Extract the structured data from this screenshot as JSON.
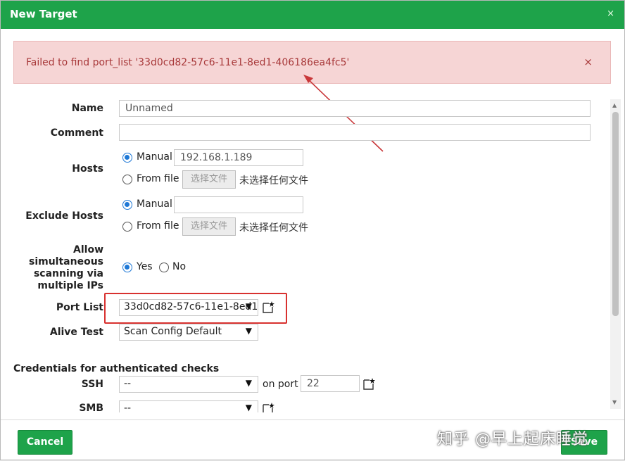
{
  "dialog": {
    "title": "New Target",
    "close": "×"
  },
  "error": {
    "message": "Failed to find port_list '33d0cd82-57c6-11e1-8ed1-406186ea4fc5'",
    "close": "×"
  },
  "form": {
    "name": {
      "label": "Name",
      "value": "Unnamed"
    },
    "comment": {
      "label": "Comment",
      "value": ""
    },
    "hosts": {
      "label": "Hosts",
      "manual_label": "Manual",
      "manual_value": "192.168.1.189",
      "file_label": "From file",
      "file_button": "选择文件",
      "file_status": "未选择任何文件",
      "selected": "manual"
    },
    "exclude_hosts": {
      "label": "Exclude Hosts",
      "manual_label": "Manual",
      "manual_value": "",
      "file_label": "From file",
      "file_button": "选择文件",
      "file_status": "未选择任何文件",
      "selected": "manual"
    },
    "simultaneous": {
      "label_lines": [
        "Allow",
        "simultaneous",
        "scanning via",
        "multiple IPs"
      ],
      "yes": "Yes",
      "no": "No",
      "selected": "yes"
    },
    "port_list": {
      "label": "Port List",
      "value": "33d0cd82-57c6-11e1-8ed1"
    },
    "alive_test": {
      "label": "Alive Test",
      "value": "Scan Config Default"
    },
    "credentials": {
      "title": "Credentials for authenticated checks",
      "ssh": {
        "label": "SSH",
        "value": "--",
        "on_port": "on port",
        "port": "22"
      },
      "smb": {
        "label": "SMB",
        "value": "--"
      }
    }
  },
  "footer": {
    "cancel": "Cancel",
    "save": "Save"
  },
  "watermark": "知乎 @早上起床睡觉",
  "icons": {
    "caret": "▼",
    "new": "new-item-icon"
  },
  "colors": {
    "brand": "#1ea34a",
    "error_bg": "#f6d5d5",
    "error_text": "#a8393a",
    "highlight": "#d8312f"
  }
}
